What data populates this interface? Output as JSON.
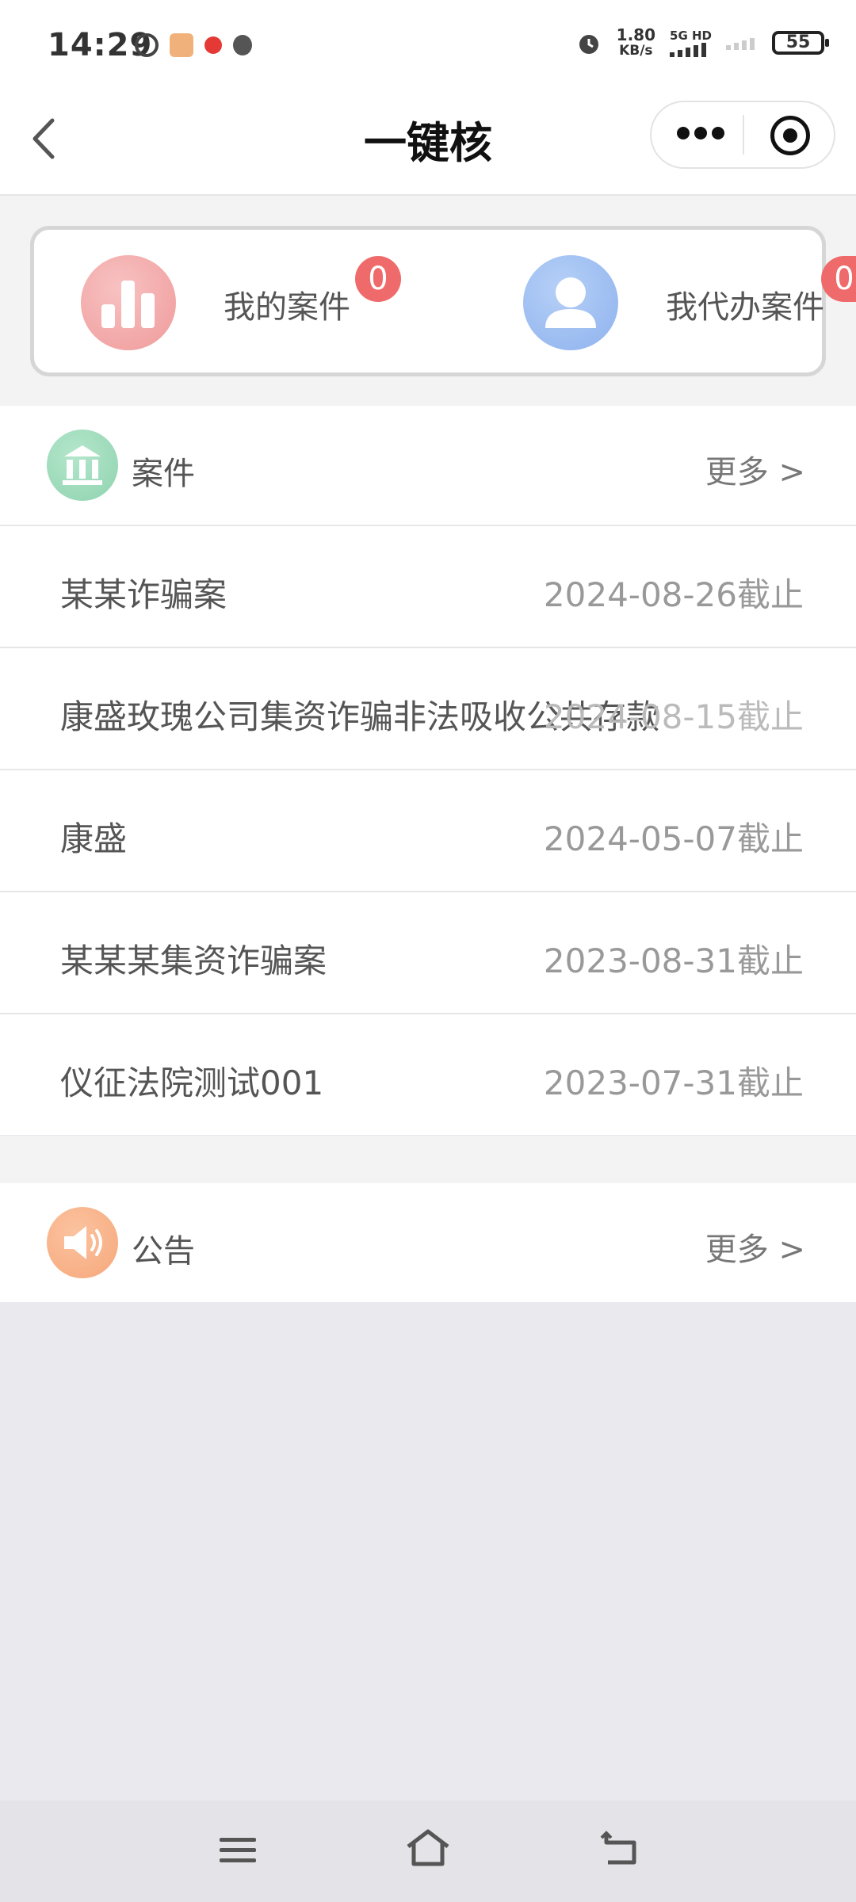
{
  "status_bar": {
    "time": "14:29",
    "net_speed_value": "1.80",
    "net_speed_unit": "KB/s",
    "network_type": "5G HD",
    "battery": "55"
  },
  "nav": {
    "title": "一键核"
  },
  "summary": {
    "my_cases_label": "我的案件",
    "my_cases_count": "0",
    "delegated_cases_label": "我代办案件",
    "delegated_cases_count": "0"
  },
  "cases_section": {
    "title": "案件",
    "more": "更多 >",
    "items": [
      {
        "name": "某某诈骗案",
        "date": "2024-08-26截止"
      },
      {
        "name": "康盛玫瑰公司集资诈骗非法吸收公共存款",
        "date": "2024-08-15截止"
      },
      {
        "name": "康盛",
        "date": "2024-05-07截止"
      },
      {
        "name": "某某某集资诈骗案",
        "date": "2023-08-31截止"
      },
      {
        "name": "仪征法院测试001",
        "date": "2023-07-31截止"
      }
    ]
  },
  "notice_section": {
    "title": "公告",
    "more": "更多 >"
  },
  "colors": {
    "badge": "#ef6b6b",
    "cases_icon": "#8fd3b0",
    "notice_icon": "#f6a77a"
  }
}
